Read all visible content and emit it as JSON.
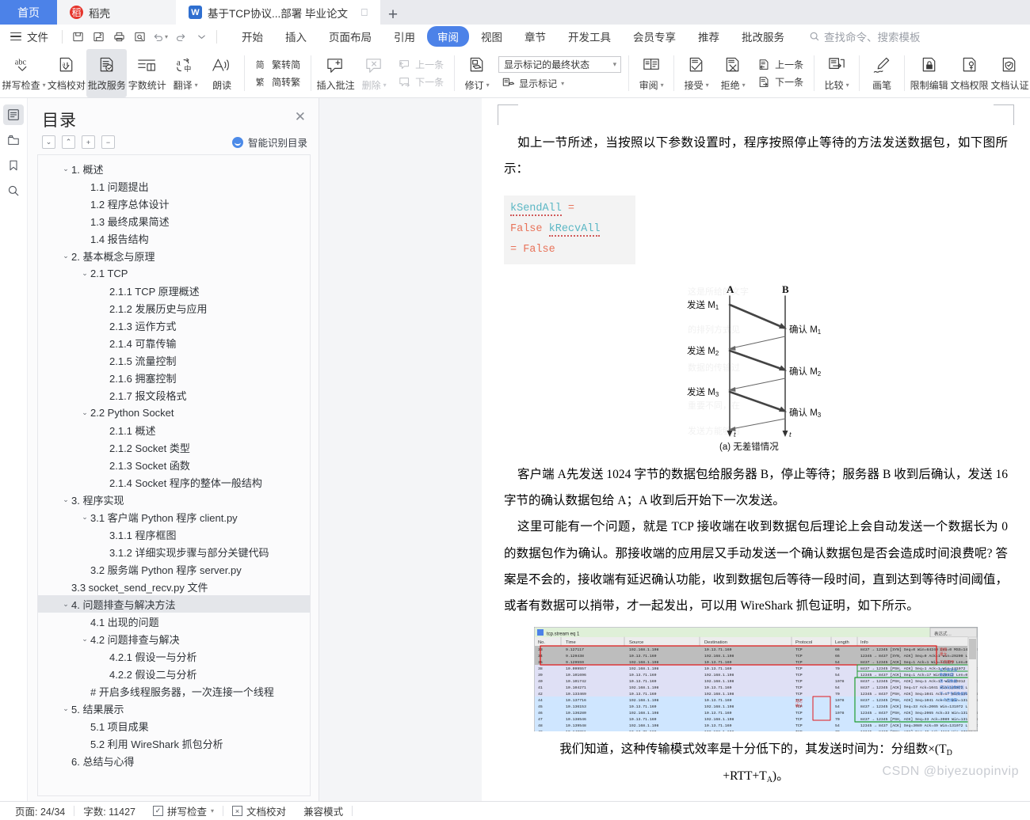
{
  "tabs": {
    "home_label": "首页",
    "docer_label": "稻壳",
    "doc_label": "基于TCP协议...部署 毕业论文",
    "new_tab": "+"
  },
  "menubar": {
    "file_label": "文件",
    "quick_icons": [
      "save-icon",
      "save-as-icon",
      "print-icon",
      "print-preview-icon",
      "undo-icon",
      "redo-icon",
      "customize-icon"
    ],
    "items": [
      {
        "label": "开始",
        "selected": false
      },
      {
        "label": "插入",
        "selected": false
      },
      {
        "label": "页面布局",
        "selected": false
      },
      {
        "label": "引用",
        "selected": false
      },
      {
        "label": "审阅",
        "selected": true
      },
      {
        "label": "视图",
        "selected": false
      },
      {
        "label": "章节",
        "selected": false
      },
      {
        "label": "开发工具",
        "selected": false
      },
      {
        "label": "会员专享",
        "selected": false
      },
      {
        "label": "推荐",
        "selected": false
      },
      {
        "label": "批改服务",
        "selected": false
      }
    ],
    "search_placeholder": "查找命令、搜索模板"
  },
  "ribbon": {
    "spell_check": "拼写检查",
    "doc_proof": "文档校对",
    "revise_service": "批改服务",
    "word_count": "字数统计",
    "translate": "翻译",
    "read_aloud": "朗读",
    "trad_to_simp": "繁转简",
    "simp_to_trad": "简转繁",
    "insert_comment": "插入批注",
    "delete_comment": "删除",
    "prev_comment": "上一条",
    "next_comment": "下一条",
    "track_changes": "修订",
    "show_markup": "显示标记",
    "markup_state": "显示标记的最终状态",
    "review_pane": "审阅",
    "accept": "接受",
    "reject": "拒绝",
    "prev_change": "上一条",
    "next_change": "下一条",
    "compare": "比较",
    "brush": "画笔",
    "restrict_edit": "限制编辑",
    "doc_permission": "文档权限",
    "doc_certify": "文档认证"
  },
  "left_rail": [
    "outline-icon",
    "thumbnail-icon",
    "bookmark-icon",
    "search-icon"
  ],
  "toc": {
    "title": "目录",
    "close": "✕",
    "tools": [
      "collapse-down-icon",
      "collapse-up-icon",
      "expand-all-icon",
      "collapse-all-icon"
    ],
    "smart_label": "智能识别目录",
    "items": [
      {
        "label": "1. 概述",
        "level": 1,
        "chev": "⌄",
        "selected": false
      },
      {
        "label": "1.1 问题提出",
        "level": 2,
        "chev": "",
        "selected": false
      },
      {
        "label": "1.2 程序总体设计",
        "level": 2,
        "chev": "",
        "selected": false
      },
      {
        "label": "1.3 最终成果简述",
        "level": 2,
        "chev": "",
        "selected": false
      },
      {
        "label": "1.4 报告结构",
        "level": 2,
        "chev": "",
        "selected": false
      },
      {
        "label": "2. 基本概念与原理",
        "level": 1,
        "chev": "⌄",
        "selected": false
      },
      {
        "label": "2.1 TCP",
        "level": 2,
        "chev": "⌄",
        "selected": false
      },
      {
        "label": "2.1.1 TCP 原理概述",
        "level": 3,
        "chev": "",
        "selected": false
      },
      {
        "label": "2.1.2 发展历史与应用",
        "level": 3,
        "chev": "",
        "selected": false
      },
      {
        "label": "2.1.3 运作方式",
        "level": 3,
        "chev": "",
        "selected": false
      },
      {
        "label": "2.1.4 可靠传输",
        "level": 3,
        "chev": "",
        "selected": false
      },
      {
        "label": "2.1.5 流量控制",
        "level": 3,
        "chev": "",
        "selected": false
      },
      {
        "label": "2.1.6 拥塞控制",
        "level": 3,
        "chev": "",
        "selected": false
      },
      {
        "label": "2.1.7 报文段格式",
        "level": 3,
        "chev": "",
        "selected": false
      },
      {
        "label": "2.2 Python Socket",
        "level": 2,
        "chev": "⌄",
        "selected": false
      },
      {
        "label": "2.1.1 概述",
        "level": 3,
        "chev": "",
        "selected": false
      },
      {
        "label": "2.1.2 Socket 类型",
        "level": 3,
        "chev": "",
        "selected": false
      },
      {
        "label": "2.1.3 Socket 函数",
        "level": 3,
        "chev": "",
        "selected": false
      },
      {
        "label": "2.1.4 Socket 程序的整体一般结构",
        "level": 3,
        "chev": "",
        "selected": false
      },
      {
        "label": "3. 程序实现",
        "level": 1,
        "chev": "⌄",
        "selected": false
      },
      {
        "label": "3.1 客户端 Python 程序 client.py",
        "level": 2,
        "chev": "⌄",
        "selected": false
      },
      {
        "label": "3.1.1 程序框图",
        "level": 3,
        "chev": "",
        "selected": false
      },
      {
        "label": "3.1.2 详细实现步骤与部分关键代码",
        "level": 3,
        "chev": "",
        "selected": false
      },
      {
        "label": "3.2 服务端 Python 程序 server.py",
        "level": 2,
        "chev": "",
        "selected": false
      },
      {
        "label": "3.3 socket_send_recv.py 文件",
        "level": 1,
        "chev": "",
        "selected": false
      },
      {
        "label": "4. 问题排查与解决方法",
        "level": 1,
        "chev": "⌄",
        "selected": true
      },
      {
        "label": "4.1 出现的问题",
        "level": 2,
        "chev": "",
        "selected": false
      },
      {
        "label": "4.2 问题排查与解决",
        "level": 2,
        "chev": "⌄",
        "selected": false
      },
      {
        "label": "4.2.1 假设一与分析",
        "level": 3,
        "chev": "",
        "selected": false
      },
      {
        "label": "4.2.2 假设二与分析",
        "level": 3,
        "chev": "",
        "selected": false
      },
      {
        "label": "# 开启多线程服务器，一次连接一个线程",
        "level": 2,
        "chev": "",
        "selected": false
      },
      {
        "label": "5. 结果展示",
        "level": 1,
        "chev": "⌄",
        "selected": false
      },
      {
        "label": "5.1 项目成果",
        "level": 2,
        "chev": "",
        "selected": false
      },
      {
        "label": "5.2 利用 WireShark 抓包分析",
        "level": 2,
        "chev": "",
        "selected": false
      },
      {
        "label": "6. 总结与心得",
        "level": 1,
        "chev": "",
        "selected": false
      }
    ]
  },
  "document": {
    "para1": "如上一节所述，当按照以下参数设置时，程序按照停止等待的方法发送数据包，如下图所示：",
    "code_line1_var1": "kSendAll",
    "code_line1_op": " = ",
    "code_line1_val1": "False",
    "code_line1_var2": "kRecvAll",
    "code_line2": "= False",
    "figure": {
      "caption": "(a) 无差错情况",
      "node_a": "A",
      "node_b": "B",
      "send_labels": [
        "发送 M₁",
        "发送 M₂",
        "发送 M₃"
      ],
      "ack_labels": [
        "确认 M₁",
        "确认 M₂",
        "确认 M₃"
      ],
      "axis_label": "t"
    },
    "para2": "客户端 A先发送 1024 字节的数据包给服务器 B，停止等待；服务器 B 收到后确认，发送 16字节的确认数据包给 A；A 收到后开始下一次发送。",
    "para3": "这里可能有一个问题，就是 TCP 接收端在收到数据包后理论上会自动发送一个数据长为 0 的数据包作为确认。那接收端的应用层又手动发送一个确认数据包是否会造成时间浪费呢? 答案是不会的，接收端有延迟确认功能，收到数据包后等待一段时间，直到达到等待时间阈值，或者有数据可以捎带，才一起发出，可以用 WireShark 抓包证明，如下所示。",
    "wireshark": {
      "filter": "tcp.stream eq 1",
      "columns": [
        "No.",
        "Time",
        "Source",
        "Destination",
        "Protocol",
        "Length",
        "Info"
      ],
      "rows": [
        {
          "no": "33",
          "time": "9.127117",
          "src": "192.168.1.198",
          "dst": "10.13.71.169",
          "proto": "TCP",
          "len": "66",
          "info": "8437 → 12345 [SYN] Seq=0 Win=64240 Len=0 MSS=1460 WS=256 SACK_PERM=1"
        },
        {
          "no": "34",
          "time": "9.129438",
          "src": "10.13.71.169",
          "dst": "192.168.1.198",
          "proto": "TCP",
          "len": "66",
          "info": "12345 → 8437 [SYN, ACK] Seq=0 Ack=1 Win=29200 Len=0 MSS=1460 SACK_PERM=1 WS=128"
        },
        {
          "no": "35",
          "time": "9.129559",
          "src": "192.168.1.198",
          "dst": "10.13.71.169",
          "proto": "TCP",
          "len": "54",
          "info": "8437 → 12345 [ACK] Seq=1 Ack=1 Win=131072 Len=0"
        },
        {
          "no": "38",
          "time": "10.099557",
          "src": "192.168.1.198",
          "dst": "10.13.71.169",
          "proto": "TCP",
          "len": "70",
          "info": "8437 → 12345 [PSH, ACK] Seq=1 Ack=1 Win=131072 Len=16"
        },
        {
          "no": "39",
          "time": "10.101696",
          "src": "10.13.71.169",
          "dst": "192.168.1.198",
          "proto": "TCP",
          "len": "54",
          "info": "12345 → 8437 [ACK] Seq=1 Ack=17 Win=29312 Len=0"
        },
        {
          "no": "40",
          "time": "10.101742",
          "src": "10.13.71.169",
          "dst": "192.168.1.198",
          "proto": "TCP",
          "len": "1078",
          "info": "8437 → 12345 [PSH, ACK] Seq=1 Ack=17 Win=29312 Len=1024"
        },
        {
          "no": "41",
          "time": "10.104271",
          "src": "192.168.1.198",
          "dst": "10.13.71.169",
          "proto": "TCP",
          "len": "54",
          "info": "8437 → 12345 [ACK] Seq=17 Ack=1041 Win=131072 Len=0"
        },
        {
          "no": "42",
          "time": "10.133469",
          "src": "10.13.71.169",
          "dst": "192.168.1.198",
          "proto": "TCP",
          "len": "70",
          "info": "12345 → 8437 [PSH, ACK] Seq=1041 Ack=17 Win=131072 Len=1024"
        },
        {
          "no": "44",
          "time": "10.137716",
          "src": "192.168.1.198",
          "dst": "10.13.71.169",
          "proto": "TCP",
          "len": "1078",
          "info": "8437 → 12345 [PSH, ACK] Seq=1041 Ack=17 Win=131072 Len=1024"
        },
        {
          "no": "45",
          "time": "10.136153",
          "src": "10.13.71.169",
          "dst": "192.168.1.198",
          "proto": "TCP",
          "len": "54",
          "info": "8437 → 12345 [ACK] Seq=33 Ack=2065 Win=131072 Len=0"
        },
        {
          "no": "46",
          "time": "10.136280",
          "src": "192.168.1.198",
          "dst": "10.13.71.169",
          "proto": "TCP",
          "len": "1078",
          "info": "12345 → 8437 [PSH, ACK] Seq=2065 Ack=33 Win=131072 Len=1024"
        },
        {
          "no": "47",
          "time": "10.138546",
          "src": "10.13.71.169",
          "dst": "192.168.1.198",
          "proto": "TCP",
          "len": "70",
          "info": "8437 → 12345 [PSH, ACK] Seq=33 Ack=3089 Win=131072 Len=16"
        },
        {
          "no": "48",
          "time": "10.139548",
          "src": "192.168.1.198",
          "dst": "10.13.71.169",
          "proto": "TCP",
          "len": "54",
          "info": "12345 → 8437 [ACK] Seq=3089 Ack=49 Win=131072 Len=1024"
        },
        {
          "no": "49",
          "time": "10.140951",
          "src": "10.13.71.169",
          "dst": "192.168.1.198",
          "proto": "TCP",
          "len": "70",
          "info": "12345 → 8437 [PSH, ACK] Seq=49 Ack=4113 Win=37504 Len=16"
        }
      ],
      "annotations": [
        "连接建立",
        "握手",
        "客户端发送数据长度",
        "延迟确认",
        "一个包结束",
        "成功发送数据包",
        "下一个包的数据开始",
        "一个包结束"
      ]
    },
    "para4_a": "我们知道，这种传输模式效率是十分低下的，其发送时间为：分组数×(T",
    "para4_sub1": "D",
    "para4_b": "+RTT+T",
    "para4_sub2": "A",
    "para4_c": ")。"
  },
  "status": {
    "page": "页面: 24/34",
    "words": "字数: 11427",
    "spell_check": "拼写检查",
    "doc_proof": "文档校对",
    "compat_mode": "兼容模式"
  },
  "watermark": "CSDN @biyezuopinvip",
  "colors": {
    "accent": "#4c82e8",
    "tab_home": "#4c82e8",
    "docer_red": "#e5342b",
    "toc_selected": "#e4e6ea"
  }
}
